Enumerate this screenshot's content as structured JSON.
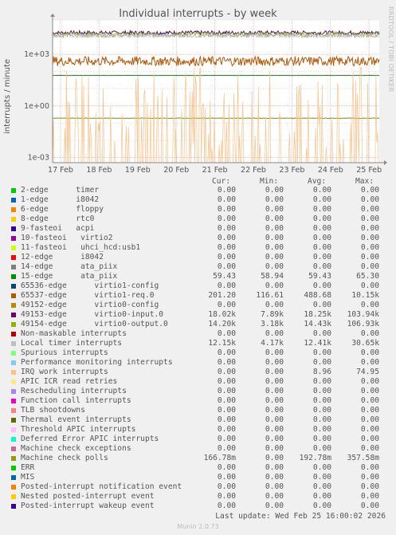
{
  "chart_data": {
    "type": "line",
    "title": "Individual interrupts - by week",
    "ylabel": "interrupts / minute",
    "yscale": "log",
    "ylim": [
      0.0005,
      100000
    ],
    "y_ticks": [
      "1e+03",
      "1e+00",
      "1e-03"
    ],
    "x_ticks": [
      "17 Feb",
      "18 Feb",
      "19 Feb",
      "20 Feb",
      "21 Feb",
      "22 Feb",
      "23 Feb",
      "24 Feb",
      "25 Feb"
    ],
    "grid": true,
    "plotted_series": [
      {
        "name": "49153-edge",
        "color": "#4a0f6e",
        "level": 18020,
        "noise": 0.22
      },
      {
        "name": "49154-edge",
        "color": "#9aa83a",
        "level": 14200,
        "noise": 0.28
      },
      {
        "name": "Local timer interrupts",
        "color": "#b8c4c4",
        "level": 12150,
        "noise": 0.18
      },
      {
        "name": "65537-edge",
        "color": "#b35806",
        "level": 400,
        "noise": 0.55
      },
      {
        "name": "15-edge",
        "color": "#1f7a1f",
        "level": 59.43,
        "noise": 0.01
      },
      {
        "name": "Machine check polls",
        "color": "#8c8c14",
        "level": 0.1928,
        "noise": 0.03
      },
      {
        "name": "IRQ work interrupts",
        "color": "#f6c28b",
        "level": 0.0005,
        "noise": 0.0,
        "spiky": true
      }
    ]
  },
  "legend": {
    "headers": [
      "Cur:",
      "Min:",
      "Avg:",
      "Max:"
    ],
    "rows": [
      {
        "name": "2-edge      timer",
        "color": "#00cc00",
        "cur": "0.00",
        "min": "0.00",
        "avg": "0.00",
        "max": "0.00"
      },
      {
        "name": "1-edge      i8042",
        "color": "#0066b3",
        "cur": "0.00",
        "min": "0.00",
        "avg": "0.00",
        "max": "0.00"
      },
      {
        "name": "6-edge      floppy",
        "color": "#ff8000",
        "cur": "0.00",
        "min": "0.00",
        "avg": "0.00",
        "max": "0.00"
      },
      {
        "name": "8-edge      rtc0",
        "color": "#ffcc00",
        "cur": "0.00",
        "min": "0.00",
        "avg": "0.00",
        "max": "0.00"
      },
      {
        "name": "9-fasteoi   acpi",
        "color": "#330099",
        "cur": "0.00",
        "min": "0.00",
        "avg": "0.00",
        "max": "0.00"
      },
      {
        "name": "10-fasteoi   virtio2",
        "color": "#990099",
        "cur": "0.00",
        "min": "0.00",
        "avg": "0.00",
        "max": "0.00"
      },
      {
        "name": "11-fasteoi   uhci_hcd:usb1",
        "color": "#ccff00",
        "cur": "0.00",
        "min": "0.00",
        "avg": "0.00",
        "max": "0.00"
      },
      {
        "name": "12-edge      i8042",
        "color": "#ff0000",
        "cur": "0.00",
        "min": "0.00",
        "avg": "0.00",
        "max": "0.00"
      },
      {
        "name": "14-edge      ata_piix",
        "color": "#808080",
        "cur": "0.00",
        "min": "0.00",
        "avg": "0.00",
        "max": "0.00"
      },
      {
        "name": "15-edge      ata_piix",
        "color": "#008f00",
        "cur": "59.43",
        "min": "58.94",
        "avg": "59.43",
        "max": "65.30"
      },
      {
        "name": "65536-edge      virtio1-config",
        "color": "#00487d",
        "cur": "0.00",
        "min": "0.00",
        "avg": "0.00",
        "max": "0.00"
      },
      {
        "name": "65537-edge      virtio1-req.0",
        "color": "#b35a00",
        "cur": "201.20",
        "min": "116.61",
        "avg": "488.68",
        "max": "10.15k"
      },
      {
        "name": "49152-edge      virtio0-config",
        "color": "#b38f00",
        "cur": "0.00",
        "min": "0.00",
        "avg": "0.00",
        "max": "0.00"
      },
      {
        "name": "49153-edge      virtio0-input.0",
        "color": "#6b006b",
        "cur": "18.02k",
        "min": "7.89k",
        "avg": "18.25k",
        "max": "103.94k"
      },
      {
        "name": "49154-edge      virtio0-output.0",
        "color": "#8fb300",
        "cur": "14.20k",
        "min": "3.18k",
        "avg": "14.43k",
        "max": "106.93k"
      },
      {
        "name": "Non-maskable interrupts",
        "color": "#b30000",
        "cur": "0.00",
        "min": "0.00",
        "avg": "0.00",
        "max": "0.00"
      },
      {
        "name": "Local timer interrupts",
        "color": "#bebebe",
        "cur": "12.15k",
        "min": "4.17k",
        "avg": "12.41k",
        "max": "30.65k"
      },
      {
        "name": "Spurious interrupts",
        "color": "#80ff80",
        "cur": "0.00",
        "min": "0.00",
        "avg": "0.00",
        "max": "0.00"
      },
      {
        "name": "Performance monitoring interrupts",
        "color": "#80c9ff",
        "cur": "0.00",
        "min": "0.00",
        "avg": "0.00",
        "max": "0.00"
      },
      {
        "name": "IRQ work interrupts",
        "color": "#ffc080",
        "cur": "0.00",
        "min": "0.00",
        "avg": "8.96",
        "max": "74.95"
      },
      {
        "name": "APIC ICR read retries",
        "color": "#ffe680",
        "cur": "0.00",
        "min": "0.00",
        "avg": "0.00",
        "max": "0.00"
      },
      {
        "name": "Rescheduling interrupts",
        "color": "#aa80ff",
        "cur": "0.00",
        "min": "0.00",
        "avg": "0.00",
        "max": "0.00"
      },
      {
        "name": "Function call interrupts",
        "color": "#ee00cc",
        "cur": "0.00",
        "min": "0.00",
        "avg": "0.00",
        "max": "0.00"
      },
      {
        "name": "TLB shootdowns",
        "color": "#ff8080",
        "cur": "0.00",
        "min": "0.00",
        "avg": "0.00",
        "max": "0.00"
      },
      {
        "name": "Thermal event interrupts",
        "color": "#666600",
        "cur": "0.00",
        "min": "0.00",
        "avg": "0.00",
        "max": "0.00"
      },
      {
        "name": "Threshold APIC interrupts",
        "color": "#ffbfff",
        "cur": "0.00",
        "min": "0.00",
        "avg": "0.00",
        "max": "0.00"
      },
      {
        "name": "Deferred Error APIC interrupts",
        "color": "#00ffcc",
        "cur": "0.00",
        "min": "0.00",
        "avg": "0.00",
        "max": "0.00"
      },
      {
        "name": "Machine check exceptions",
        "color": "#cc6699",
        "cur": "0.00",
        "min": "0.00",
        "avg": "0.00",
        "max": "0.00"
      },
      {
        "name": "Machine check polls",
        "color": "#999900",
        "cur": "166.78m",
        "min": "0.00",
        "avg": "192.78m",
        "max": "357.58m"
      },
      {
        "name": "ERR",
        "color": "#00cc00",
        "cur": "0.00",
        "min": "0.00",
        "avg": "0.00",
        "max": "0.00"
      },
      {
        "name": "MIS",
        "color": "#0066b3",
        "cur": "0.00",
        "min": "0.00",
        "avg": "0.00",
        "max": "0.00"
      },
      {
        "name": "Posted-interrupt notification event",
        "color": "#ff8000",
        "cur": "0.00",
        "min": "0.00",
        "avg": "0.00",
        "max": "0.00"
      },
      {
        "name": "Nested posted-interrupt event",
        "color": "#ffcc00",
        "cur": "0.00",
        "min": "0.00",
        "avg": "0.00",
        "max": "0.00"
      },
      {
        "name": "Posted-interrupt wakeup event",
        "color": "#330099",
        "cur": "0.00",
        "min": "0.00",
        "avg": "0.00",
        "max": "0.00"
      }
    ]
  },
  "footer": {
    "last_update": "Last update: Wed Feb 25 16:00:02 2026",
    "munin_version": "Munin 2.0.73",
    "side_text": "RRDTOOL / TOBI OETIKER"
  }
}
